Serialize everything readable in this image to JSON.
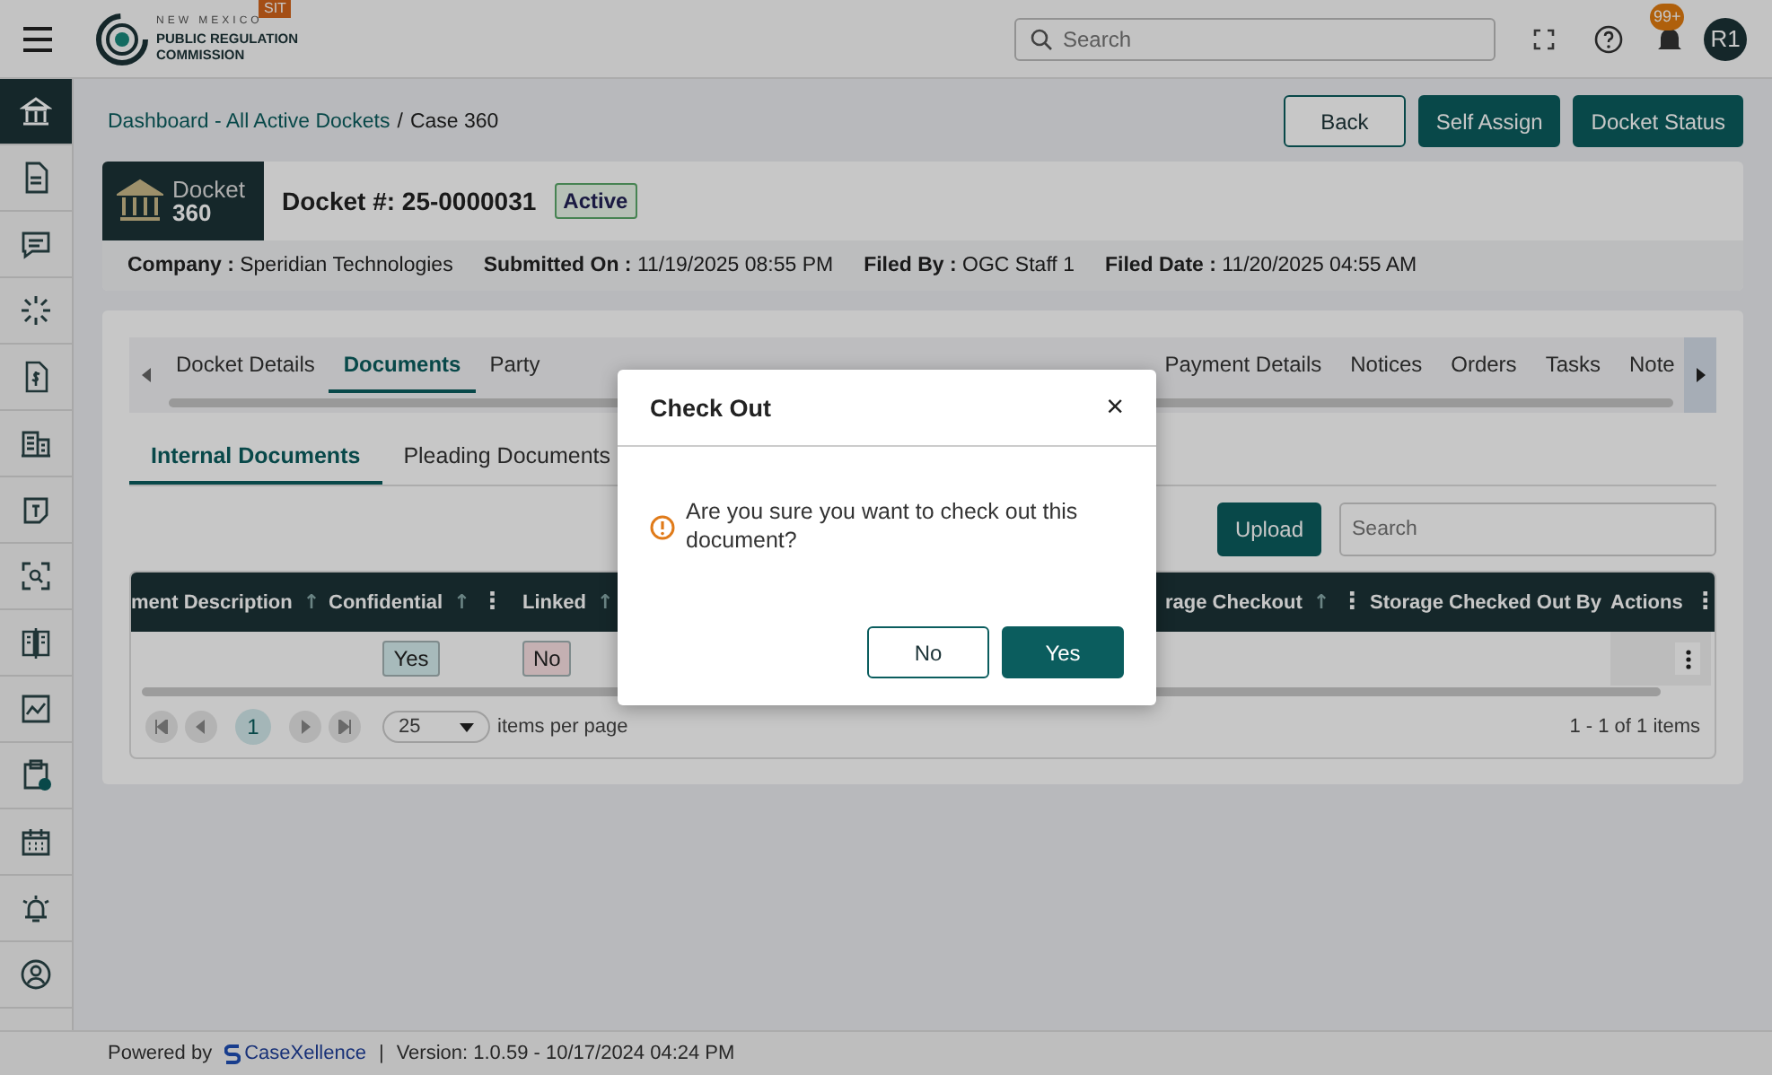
{
  "header": {
    "logo_lines": [
      "NEW MEXICO",
      "PUBLIC REGULATION",
      "COMMISSION"
    ],
    "env_badge": "SIT",
    "search": {
      "placeholder": "Search"
    },
    "notification_count": "99+",
    "avatar": "R1"
  },
  "sidebar": {
    "items": [
      {
        "kind": "bank",
        "selected": true
      },
      {
        "kind": "document",
        "selected": false
      },
      {
        "kind": "chat",
        "selected": false
      },
      {
        "kind": "burst",
        "selected": false
      },
      {
        "kind": "invoice",
        "selected": false
      },
      {
        "kind": "building",
        "selected": false
      },
      {
        "kind": "note",
        "selected": false
      },
      {
        "kind": "scan",
        "selected": false
      },
      {
        "kind": "book",
        "selected": false
      },
      {
        "kind": "chart",
        "selected": false
      },
      {
        "kind": "clipboard",
        "selected": false
      },
      {
        "kind": "calendar",
        "selected": false
      },
      {
        "kind": "alarm",
        "selected": false
      },
      {
        "kind": "user",
        "selected": false
      }
    ]
  },
  "breadcrumb": {
    "link": "Dashboard - All Active Dockets",
    "separator": "/",
    "current": "Case 360"
  },
  "actions": [
    {
      "label": "Back",
      "kind": "outline"
    },
    {
      "label": "Self Assign",
      "kind": "primary"
    },
    {
      "label": "Docket Status",
      "kind": "primary"
    }
  ],
  "docket": {
    "badge_title": "Docket",
    "badge_number": "360",
    "number": "Docket #: 25-0000031",
    "status": "Active",
    "info": [
      {
        "label": "Company :",
        "value": "Speridian Technologies"
      },
      {
        "label": "Submitted On :",
        "value": "11/19/2025 08:55 PM"
      },
      {
        "label": "Filed By :",
        "value": "OGC Staff 1"
      },
      {
        "label": "Filed Date :",
        "value": "11/20/2025 04:55 AM"
      }
    ]
  },
  "tabs": [
    {
      "label": "Docket Details",
      "selected": false
    },
    {
      "label": "Documents",
      "selected": true
    },
    {
      "label": "Party",
      "selected": false
    },
    {
      "label": "Payment Details",
      "selected": false
    },
    {
      "label": "Notices",
      "selected": false
    },
    {
      "label": "Orders",
      "selected": false
    },
    {
      "label": "Tasks",
      "selected": false
    },
    {
      "label": "Note",
      "selected": false
    }
  ],
  "sub_tabs": [
    {
      "label": "Internal Documents",
      "selected": true
    },
    {
      "label": "Pleading Documents",
      "selected": false
    }
  ],
  "toolbar": {
    "upload": "Upload",
    "search": {
      "placeholder": "Search"
    }
  },
  "table": {
    "columns": [
      {
        "label": "ment Description",
        "icons": [
          {
            "kind": "sort",
            "glyph": "↑"
          }
        ]
      },
      {
        "label": "Confidential",
        "icons": [
          {
            "kind": "sort",
            "glyph": "↑"
          },
          {
            "kind": "menu",
            "glyph": "⋮"
          }
        ]
      },
      {
        "label": "Linked",
        "icons": [
          {
            "kind": "sort",
            "glyph": "↑"
          }
        ]
      },
      {
        "label": "rage Checkout",
        "icons": [
          {
            "kind": "sort",
            "glyph": "↑"
          },
          {
            "kind": "menu",
            "glyph": "⋮"
          }
        ]
      },
      {
        "label": "Storage Checked Out By"
      },
      {
        "label": "Actions",
        "icons": [
          {
            "kind": "menu",
            "glyph": "⋮"
          }
        ]
      }
    ],
    "rows": [
      {
        "confidential": {
          "text": "Yes",
          "color": "#a7babb"
        },
        "linked": {
          "text": "No",
          "color": "#c4b0b2"
        }
      }
    ]
  },
  "pager": {
    "page": "1",
    "page_size": "25",
    "per_page": "items per page",
    "range": "1 - 1 of 1 items"
  },
  "modal": {
    "title": "Check Out",
    "close": "×",
    "message": "Are you sure you want to check out this document?",
    "buttons": [
      {
        "label": "No",
        "kind": "outline"
      },
      {
        "label": "Yes",
        "kind": "primary"
      }
    ]
  },
  "footer": {
    "powered": "Powered by",
    "brand": "CaseXellence",
    "separator": "|",
    "version": "Version: 1.0.59 - 10/17/2024 04:24 PM"
  }
}
